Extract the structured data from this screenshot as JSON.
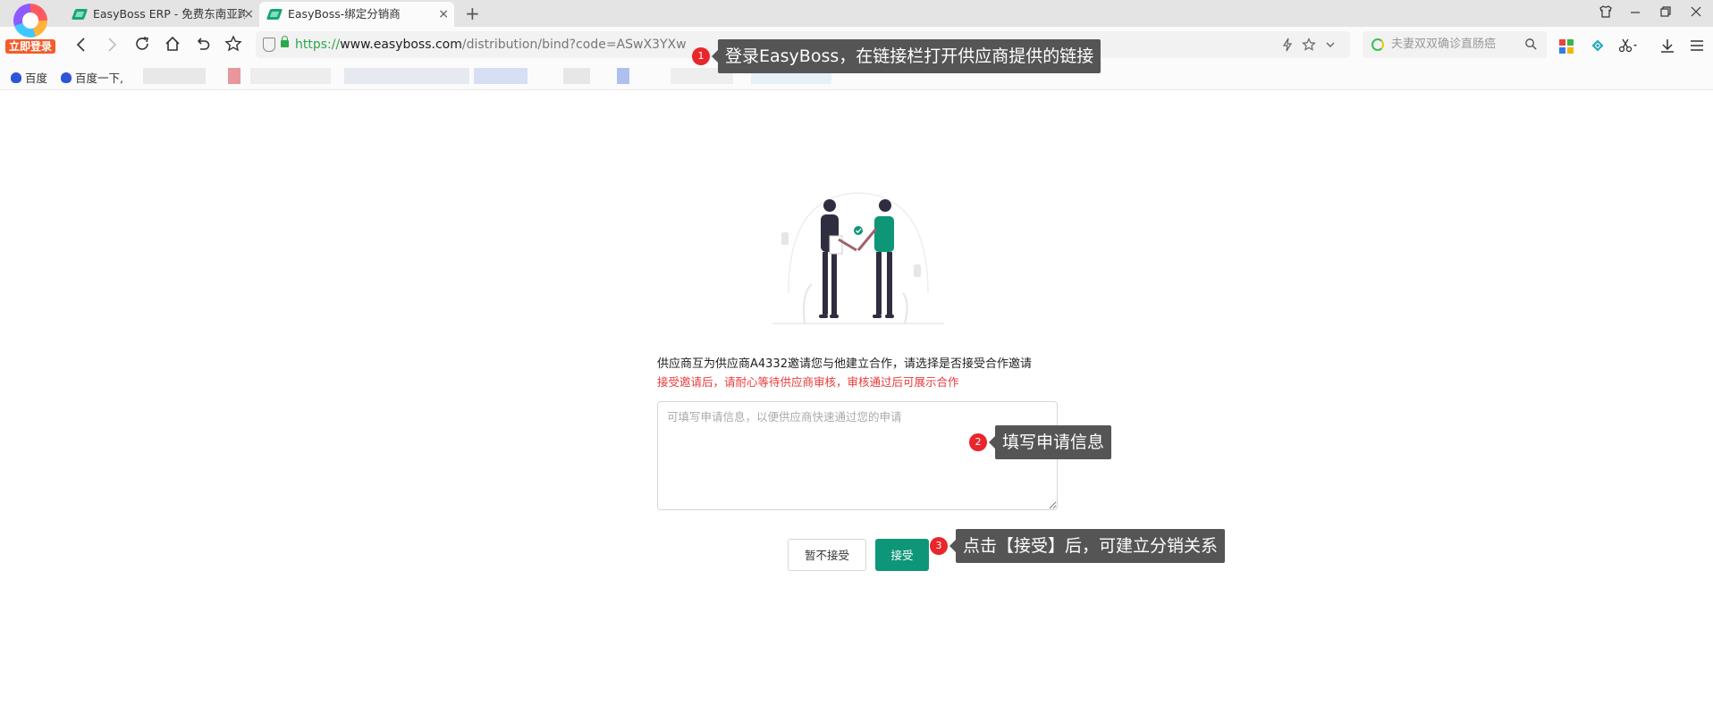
{
  "browser": {
    "login_badge": "立即登录",
    "tabs": [
      {
        "title": "EasyBoss ERP - 免费东南亚跨",
        "close": "×"
      },
      {
        "title": "EasyBoss-绑定分销商",
        "close": "×"
      }
    ],
    "new_tab": "+",
    "url": {
      "scheme": "https://",
      "host": "www.easyboss.com",
      "path": "/distribution/bind?code=ASwX3YXw"
    },
    "search": {
      "placeholder": "夫妻双双确诊直肠癌"
    },
    "bookmarks": [
      {
        "label": "百度"
      },
      {
        "label": "百度一下,"
      }
    ]
  },
  "page": {
    "invite_text": "供应商互为供应商A4332邀请您与他建立合作，请选择是否接受合作邀请",
    "hint_text": "接受邀请后，请耐心等待供应商审核，审核通过后可展示合作",
    "apply_placeholder": "可填写申请信息，以便供应商快速通过您的申请",
    "decline_label": "暂不接受",
    "accept_label": "接受"
  },
  "annotations": [
    {
      "number": "1",
      "text": "登录EasyBoss，在链接栏打开供应商提供的链接"
    },
    {
      "number": "2",
      "text": "填写申请信息"
    },
    {
      "number": "3",
      "text": "点击【接受】后，可建立分销关系"
    }
  ],
  "colors": {
    "accent_green": "#0e9678",
    "hint_red": "#e83a3a",
    "marker_red": "#e8262b",
    "callout_bg": "#555555"
  }
}
